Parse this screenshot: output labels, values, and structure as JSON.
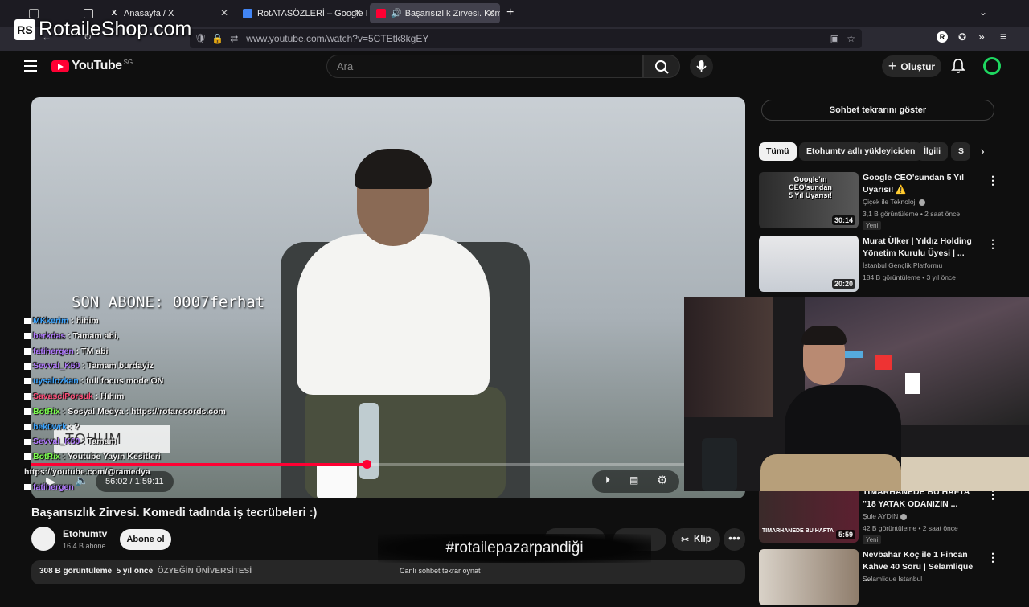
{
  "brand_overlay": {
    "text": "RotaileShop.com",
    "logo": "RS"
  },
  "browser": {
    "tabs": [
      {
        "label": "",
        "icon": "extension-tab-icon"
      },
      {
        "label": "Anasayfa / X",
        "icon": "x-logo-icon"
      },
      {
        "label": "RotATASÖZLERİ – Google Dokü",
        "icon": "google-docs-icon"
      },
      {
        "label": "Başarısızlık Zirvesi. Komedi",
        "icon": "youtube-icon",
        "active": true
      }
    ],
    "url": "www.youtube.com/watch?v=5CTEtk8kgEY",
    "profile_initial": "R"
  },
  "youtube": {
    "logo_text": "YouTube",
    "country_code": "SG",
    "search_placeholder": "Ara",
    "create_label": "Oluştur"
  },
  "video": {
    "overlay_text": "SON ABONE: 0007ferhat",
    "watermark": "TOHUM",
    "time_current": "56:02",
    "time_total": "1:59:11",
    "progress": 0.47,
    "url_overlay": "https://youtube.com/@ramedya"
  },
  "chat": [
    {
      "user": "MKkerim",
      "msg": ": hihim",
      "color": "#3ea6ff"
    },
    {
      "user": "berkdas",
      "msg": ": Tamam abi,",
      "color": "#b37cff"
    },
    {
      "user": "fatihergen",
      "msg": ": TM abi",
      "color": "#b37cff"
    },
    {
      "user": "Sevval_K60",
      "msg": ": Tamam burdayiz",
      "color": "#b37cff"
    },
    {
      "user": "uysalozkan",
      "msg": ": full focus mode ON",
      "color": "#3ea6ff"
    },
    {
      "user": "SavasciPorsuk",
      "msg": ": Hıhım",
      "color": "#ff4f7a"
    },
    {
      "user": "BotRix",
      "msg": ": Sosyal Medya : https://rotarecords.com",
      "color": "#7cff4f"
    },
    {
      "user": "bek0wrk",
      "msg": ": ?",
      "color": "#3ea6ff"
    },
    {
      "user": "Sevval_K60",
      "msg": ": Tamam",
      "color": "#b37cff"
    },
    {
      "user": "BotRix",
      "msg": ": Youtube Yayın Kesitleri",
      "color": "#7cff4f"
    },
    {
      "user": "",
      "msg": "https://youtube.com/@ramedya",
      "color": "#ffffff"
    },
    {
      "user": "fatihergen",
      "msg": "",
      "color": "#b37cff"
    }
  ],
  "watch": {
    "title": "Başarısızlık Zirvesi. Komedi tadında iş tecrübeleri :)",
    "channel": "Etohumtv",
    "subs": "16,4 B abone",
    "subscribe_label": "Abone ol",
    "clip_label": "Klip",
    "views": "308 B görüntüleme",
    "age": "5 yıl önce",
    "desc_tag": "ÖZYEĞİN ÜNİVERSİTESİ",
    "chat_replay_hint": "Canlı sohbet tekrar oynat"
  },
  "hashtag": "#rotailepazarpandiği",
  "sidebar": {
    "chat_replay_label": "Sohbet tekrarını göster",
    "chips": [
      "Tümü",
      "Etohumtv adlı yükleyiciden",
      "İlgili",
      "S"
    ],
    "recs": [
      {
        "title": "Google CEO'sundan 5 Yıl Uyarısı! ⚠️",
        "channel": "Çiçek ile Teknoloji",
        "meta": "3,1 B görüntüleme • 2 saat önce",
        "badge": "Yeni",
        "duration": "30:14",
        "thumb_text": "Google'ın CEO'sundan 5 Yıl Uyarısı!"
      },
      {
        "title": "Murat Ülker | Yıldız Holding Yönetim Kurulu Üyesi | ...",
        "channel": "İstanbul Gençlik Platformu",
        "meta": "184 B görüntüleme • 3 yıl önce",
        "badge": "",
        "duration": "20:20",
        "thumb_text": ""
      },
      {
        "title": "TIMARHANEDE BU HAFTA \"18 YATAK ODANIZIN ...",
        "channel": "Şule AYDIN",
        "meta": "42 B görüntüleme • 2 saat önce",
        "badge": "Yeni",
        "duration": "5:59",
        "thumb_text": "TIMARHANEDE BU HAFTA"
      },
      {
        "title": "Nevbahar Koç ile 1 Fincan Kahve 40 Soru | Selamlique ...",
        "channel": "Selamlique İstanbul",
        "meta": "",
        "badge": "",
        "duration": "",
        "thumb_text": ""
      }
    ]
  }
}
